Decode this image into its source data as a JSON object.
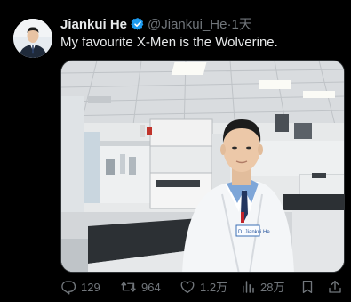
{
  "tweet": {
    "author_name": "Jiankui He",
    "handle": "@Jiankui_He",
    "separator": "·",
    "time": "1天",
    "verified_icon": "verified-badge-icon",
    "text": "My favourite X-Men is the Wolverine.",
    "media_label": "D. Jiankui He"
  },
  "actions": {
    "reply": {
      "icon": "reply-icon",
      "count": "129"
    },
    "retweet": {
      "icon": "retweet-icon",
      "count": "964"
    },
    "like": {
      "icon": "like-icon",
      "count": "1.2万"
    },
    "views": {
      "icon": "views-icon",
      "count": "28万"
    },
    "bookmark": {
      "icon": "bookmark-icon"
    },
    "share": {
      "icon": "share-icon"
    }
  },
  "colors": {
    "background": "#000000",
    "text": "#e7e9ea",
    "muted": "#71767b",
    "verified": "#1d9bf0"
  }
}
